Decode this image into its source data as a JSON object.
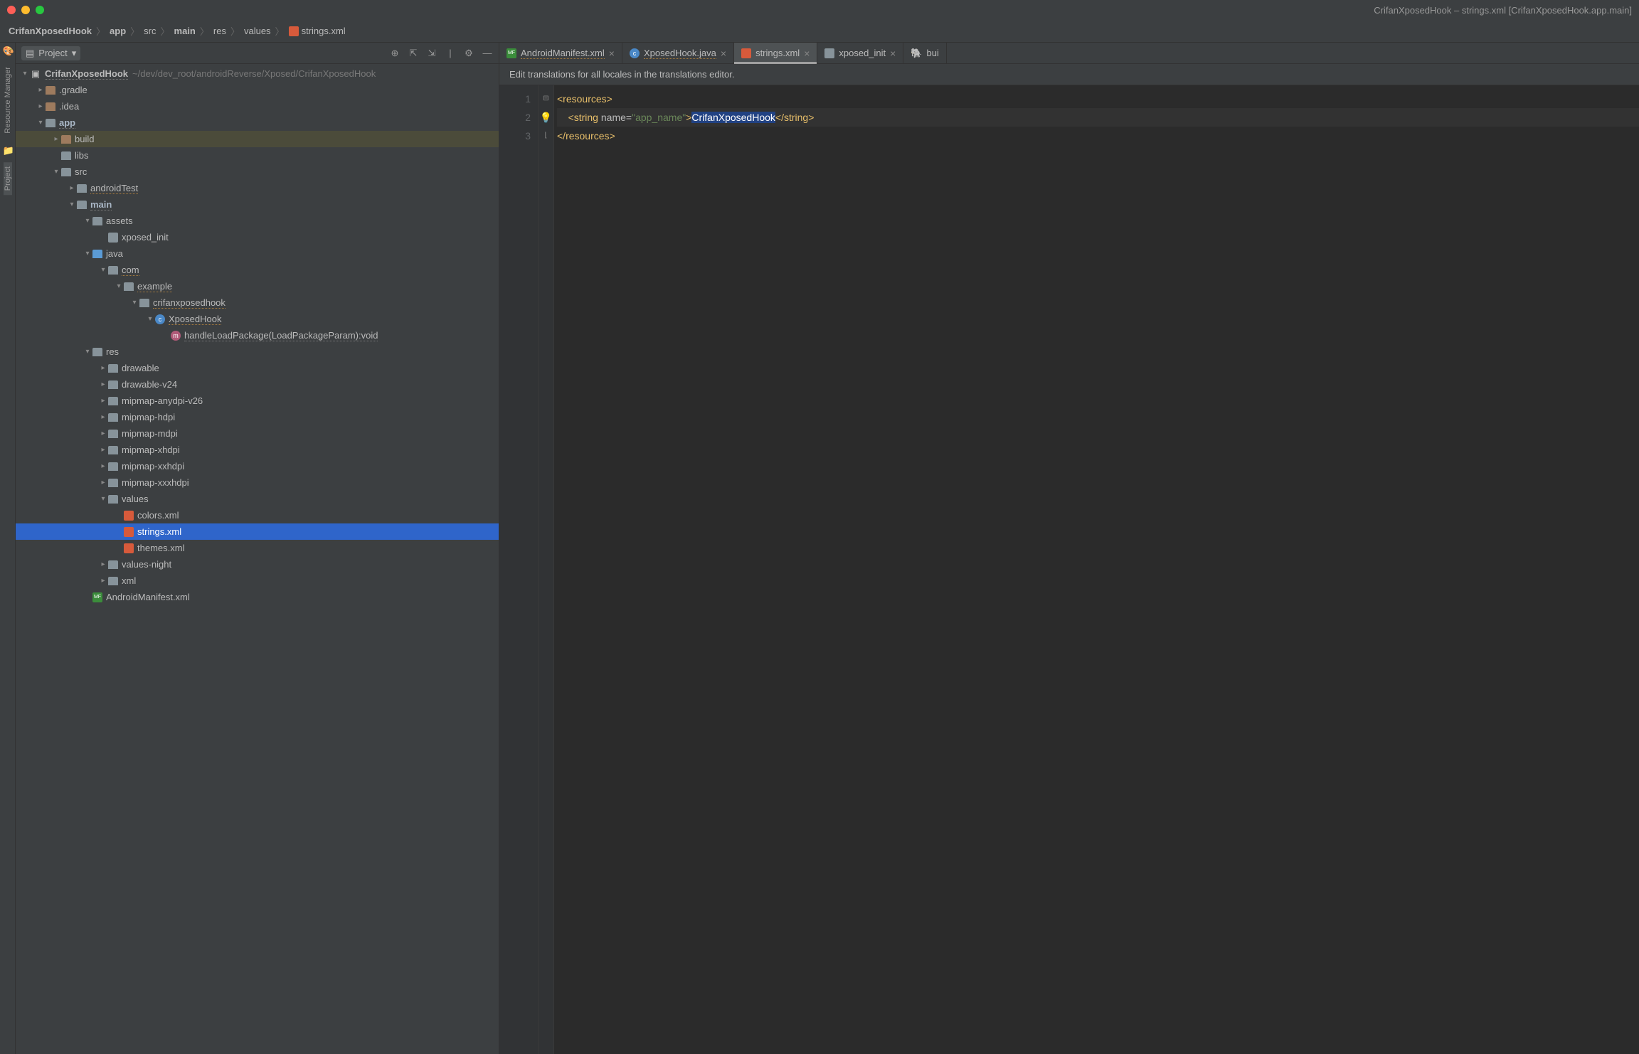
{
  "window": {
    "title": "CrifanXposedHook – strings.xml [CrifanXposedHook.app.main]"
  },
  "breadcrumbs": [
    "CrifanXposedHook",
    "app",
    "src",
    "main",
    "res",
    "values",
    "strings.xml"
  ],
  "sidebar": {
    "title": "Project"
  },
  "left_tools": {
    "resource_manager": "Resource Manager",
    "project": "Project"
  },
  "tree": {
    "root": {
      "name": "CrifanXposedHook",
      "path": "~/dev/dev_root/androidReverse/Xposed/CrifanXposedHook"
    },
    "gradle": ".gradle",
    "idea": ".idea",
    "app": "app",
    "build": "build",
    "libs": "libs",
    "src": "src",
    "androidTest": "androidTest",
    "main": "main",
    "assets": "assets",
    "xposed_init": "xposed_init",
    "java": "java",
    "com": "com",
    "example": "example",
    "crifanxposedhook": "crifanxposedhook",
    "XposedHook": "XposedHook",
    "handleLoadPackage": "handleLoadPackage(LoadPackageParam):void",
    "res": "res",
    "drawable": "drawable",
    "drawable_v24": "drawable-v24",
    "mipmap_anydpi_v26": "mipmap-anydpi-v26",
    "mipmap_hdpi": "mipmap-hdpi",
    "mipmap_mdpi": "mipmap-mdpi",
    "mipmap_xhdpi": "mipmap-xhdpi",
    "mipmap_xxhdpi": "mipmap-xxhdpi",
    "mipmap_xxxhdpi": "mipmap-xxxhdpi",
    "values": "values",
    "colors_xml": "colors.xml",
    "strings_xml": "strings.xml",
    "themes_xml": "themes.xml",
    "values_night": "values-night",
    "xml": "xml",
    "androidmanifest": "AndroidManifest.xml"
  },
  "tabs": [
    {
      "label": "AndroidManifest.xml",
      "icon": "mf"
    },
    {
      "label": "XposedHook.java",
      "icon": "class"
    },
    {
      "label": "strings.xml",
      "icon": "xml",
      "active": true
    },
    {
      "label": "xposed_init",
      "icon": "txt"
    },
    {
      "label": "bui",
      "icon": "gradle"
    }
  ],
  "banner": "Edit translations for all locales in the translations editor.",
  "code": {
    "line_numbers": [
      "1",
      "2",
      "3"
    ],
    "l1_open": "<resources>",
    "l2_tag_open": "<string",
    "l2_attr_name": "name",
    "l2_eq": "=",
    "l2_attr_val": "\"app_name\"",
    "l2_gt": ">",
    "l2_text": "CrifanXposedHook",
    "l2_tag_close": "</string>",
    "l3_close": "</resources>"
  }
}
